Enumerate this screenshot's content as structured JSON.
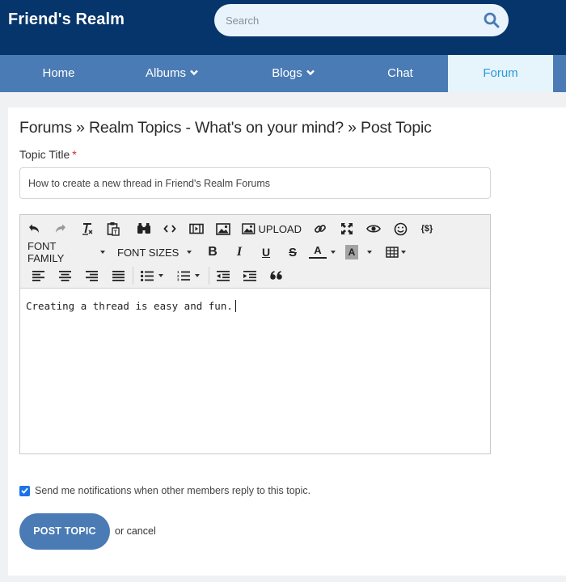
{
  "site": {
    "brand": "Friend's Realm"
  },
  "search": {
    "placeholder": "Search"
  },
  "nav": {
    "home": "Home",
    "albums": "Albums",
    "blogs": "Blogs",
    "chat": "Chat",
    "forum": "Forum"
  },
  "page": {
    "breadcrumb": "Forums » Realm Topics - What's on your mind? » Post Topic",
    "topic_title_label": "Topic Title",
    "required_mark": "*",
    "topic_title_value": "How to create a new thread in Friend's Realm Forums"
  },
  "toolbar": {
    "upload_label": "UPLOAD",
    "font_family_label": "FONT FAMILY",
    "font_sizes_label": "FONT SIZES",
    "bold_label": "B",
    "italic_label": "I",
    "underline_label": "U",
    "strike_label": "S",
    "text_color_label": "A",
    "bg_color_label": "A",
    "source_label": "{$}"
  },
  "editor": {
    "content": "Creating a thread is easy and fun."
  },
  "form": {
    "notify_label": "Send me notifications when other members reply to this topic.",
    "notify_checked": true,
    "post_button": "POST TOPIC",
    "or_text": "or",
    "cancel_link": "cancel"
  },
  "colors": {
    "header_bg": "#05356a",
    "nav_bg": "#4a7bb4",
    "nav_active_bg": "#e6f4fc",
    "nav_active_text": "#2a9ad8",
    "button_bg": "#4a7bb4",
    "checkbox": "#1a73e8"
  }
}
